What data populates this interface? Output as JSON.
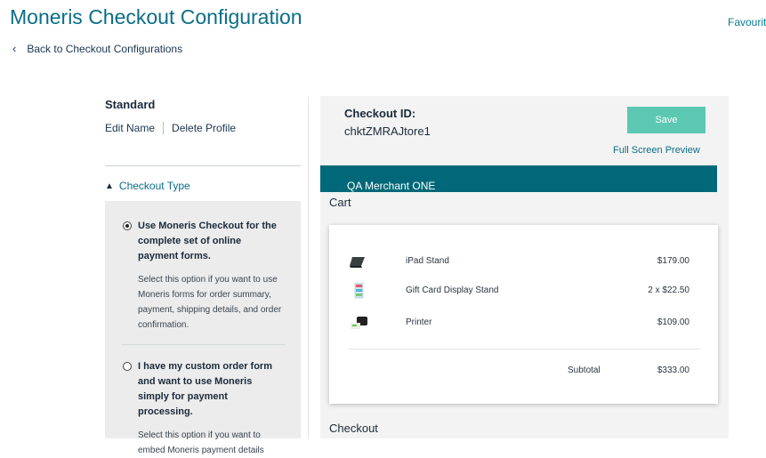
{
  "header": {
    "title": "Moneris Checkout Configuration",
    "favourite_label": "Favourite ☆",
    "back_label": "Back to Checkout Configurations",
    "back_icon": "chevron-left-icon"
  },
  "profile": {
    "name": "Standard",
    "edit_label": "Edit Name",
    "delete_label": "Delete Profile"
  },
  "checkout_type": {
    "section_label": "Checkout Type",
    "options": [
      {
        "title": "Use Moneris Checkout for the complete set of online payment forms.",
        "description": "Select this option if you want to use Moneris forms for order summary, payment, shipping details, and order confirmation.",
        "selected": true
      },
      {
        "title": "I have my custom order form and want to use Moneris simply for payment processing.",
        "description": "Select this option if you want to embed Moneris payment details",
        "selected": false
      }
    ]
  },
  "preview": {
    "checkout_id_label": "Checkout ID:",
    "checkout_id_value": "chktZMRAJtore1",
    "save_label": "Save",
    "full_screen_label": "Full Screen Preview",
    "merchant_name": "QA Merchant ONE",
    "cart_label": "Cart",
    "items": [
      {
        "name": "iPad Stand",
        "price": "$179.00",
        "icon": "ipad-stand-thumbnail"
      },
      {
        "name": "Gift Card Display Stand",
        "price": "2 x $22.50",
        "icon": "gift-card-stand-thumbnail"
      },
      {
        "name": "Printer",
        "price": "$109.00",
        "icon": "printer-thumbnail"
      }
    ],
    "subtotal_label": "Subtotal",
    "subtotal_value": "$333.00",
    "checkout_label": "Checkout"
  },
  "colors": {
    "brand_teal": "#0a6e86",
    "merchant_bar": "#006878",
    "save_button": "#5cc8b2"
  }
}
